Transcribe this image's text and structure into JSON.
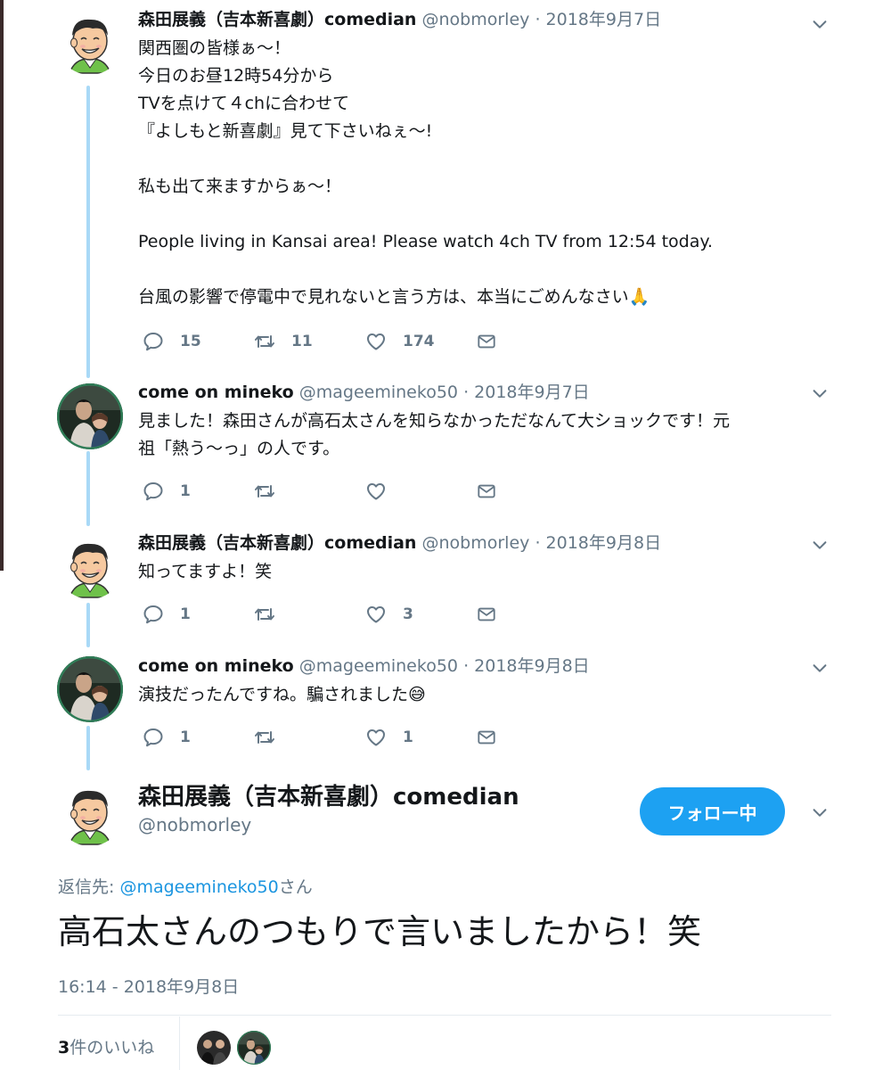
{
  "tweets": [
    {
      "name": "森田展義（吉本新喜劇）comedian",
      "handle": "@nobmorley",
      "date": "· 2018年9月7日",
      "text": "関西圏の皆様ぁ〜！\n今日のお昼12時54分から\nTVを点けて４chに合わせて\n『よしもと新喜劇』見て下さいねぇ〜!\n\n私も出て来ますからぁ〜！\n\nPeople living in Kansai area! Please watch 4ch TV from 12:54 today.\n\n台風の影響で停電中で見れないと言う方は、本当にごめんなさい🙏",
      "replies": "15",
      "retweets": "11",
      "likes": "174"
    },
    {
      "name": "come on mineko",
      "handle": "@mageemineko50",
      "date": "· 2018年9月7日",
      "text": "見ました！森田さんが高石太さんを知らなかっただなんて大ショックです！元\n祖「熱う〜っ」の人です。",
      "replies": "1",
      "retweets": "",
      "likes": ""
    },
    {
      "name": "森田展義（吉本新喜劇）comedian",
      "handle": "@nobmorley",
      "date": "· 2018年9月8日",
      "text": "知ってますよ！笑",
      "replies": "1",
      "retweets": "",
      "likes": "3"
    },
    {
      "name": "come on mineko",
      "handle": "@mageemineko50",
      "date": "· 2018年9月8日",
      "text": "演技だったんですね。騙されました😅",
      "replies": "1",
      "retweets": "",
      "likes": "1"
    }
  ],
  "focus": {
    "name": "森田展義（吉本新喜劇）comedian",
    "handle": "@nobmorley",
    "follow_label": "フォロー中",
    "reply_prefix": "返信先: ",
    "reply_handle": "@mageemineko50",
    "reply_suffix": "さん",
    "text": "高石太さんのつもりで言いましたから！笑",
    "timestamp": "16:14 - 2018年9月8日",
    "likes_count": "3",
    "likes_suffix": "件のいいね"
  },
  "colors": {
    "accent": "#1da1f2",
    "thread_line": "#a9d9f7",
    "muted": "#657786"
  },
  "icons": [
    "reply-icon",
    "retweet-icon",
    "like-icon",
    "dm-icon",
    "chevron-down-icon"
  ]
}
